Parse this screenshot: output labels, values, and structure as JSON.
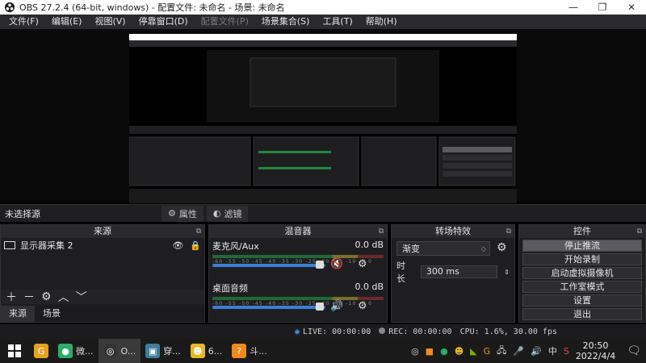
{
  "window": {
    "title": "OBS 27.2.4 (64-bit, windows) - 配置文件: 未命名 - 场景: 未命名",
    "controls": [
      "minimize",
      "maximize",
      "close"
    ]
  },
  "menu": [
    {
      "label": "文件(F)",
      "disabled": false
    },
    {
      "label": "编辑(E)",
      "disabled": false
    },
    {
      "label": "视图(V)",
      "disabled": false
    },
    {
      "label": "停靠窗口(D)",
      "disabled": false
    },
    {
      "label": "配置文件(P)",
      "disabled": true
    },
    {
      "label": "场景集合(S)",
      "disabled": false
    },
    {
      "label": "工具(T)",
      "disabled": false
    },
    {
      "label": "帮助(H)",
      "disabled": false
    }
  ],
  "source_bar": {
    "no_source": "未选择源",
    "properties_btn": "属性",
    "filters_btn": "滤镜"
  },
  "sources": {
    "header": "来源",
    "items": [
      {
        "label": "显示器采集 2",
        "visible": true,
        "locked": true
      }
    ],
    "tabs": {
      "sources": "来源",
      "scenes": "场景"
    }
  },
  "mixer": {
    "header": "混音器",
    "channels": [
      {
        "name": "麦克风/Aux",
        "level": "0.0 dB",
        "muted": true
      },
      {
        "name": "桌面音频",
        "level": "0.0 dB",
        "muted": false
      }
    ],
    "ticks": "-60 -55 -50 -45 -40 -35 -30 -25 -20 -15 -10 -5 0"
  },
  "transitions": {
    "header": "转场特效",
    "selected": "渐变",
    "duration_label": "时长",
    "duration_value": "300 ms"
  },
  "controls": {
    "header": "控件",
    "buttons": [
      "停止推流",
      "开始录制",
      "启动虚拟摄像机",
      "工作室模式",
      "设置",
      "退出"
    ]
  },
  "status": {
    "live": "LIVE: 00:00:00",
    "rec": "REC: 00:00:00",
    "cpu": "CPU: 1.6%, 30.00 fps"
  },
  "taskbar": {
    "items": [
      {
        "label": "",
        "icon": "chrome-icon"
      },
      {
        "label": "微...",
        "icon": "wechat-icon"
      },
      {
        "label": "O...",
        "icon": "obs-icon",
        "active": true
      },
      {
        "label": "穿...",
        "icon": "app-icon"
      },
      {
        "label": "6...",
        "icon": "qq-icon"
      },
      {
        "label": "斗...",
        "icon": "douyu-icon"
      }
    ],
    "tray_ime": "中",
    "time": "20:50",
    "date": "2022/4/4"
  },
  "colors": {
    "accent": "#3b7fd6",
    "panel": "#1e1e21",
    "muted": "#d02525"
  }
}
